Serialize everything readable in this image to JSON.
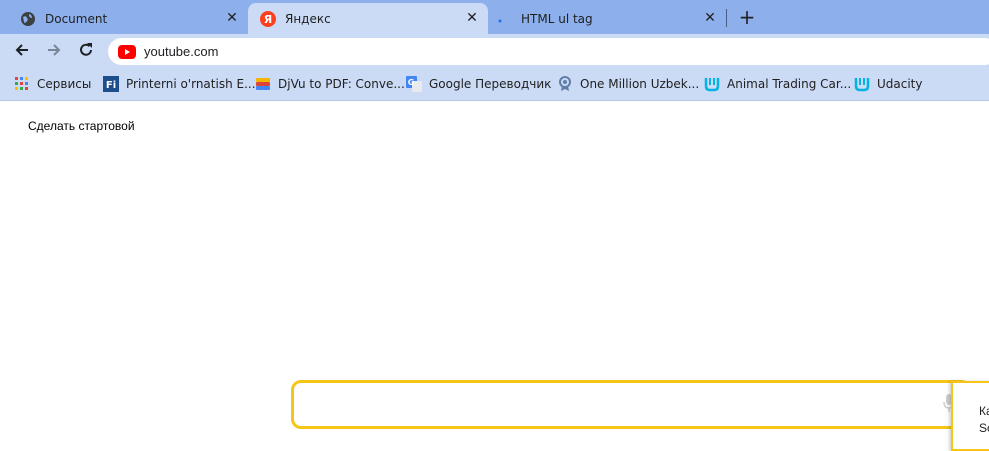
{
  "tabs": [
    {
      "title": "Document",
      "icon": "globe-icon",
      "close": "✕"
    },
    {
      "title": "Яндекс",
      "icon": "yandex-icon",
      "close": "✕"
    },
    {
      "title": "HTML ul tag",
      "icon": "dot-icon",
      "close": "✕"
    }
  ],
  "new_tab": "+",
  "toolbar": {
    "url": "youtube.com",
    "site_icon": "youtube-icon"
  },
  "bookmarks": [
    {
      "label": "Сервисы",
      "icon": "apps-grid-icon"
    },
    {
      "label": "Printerni o'rnatish E...",
      "icon": "fi-icon"
    },
    {
      "label": "DjVu to PDF: Conve...",
      "icon": "djvu-icon"
    },
    {
      "label": "Google Переводчик",
      "icon": "google-translate-icon"
    },
    {
      "label": "One Million Uzbek...",
      "icon": "ribbon-icon"
    },
    {
      "label": "Animal Trading Car...",
      "icon": "udacity-icon"
    },
    {
      "label": "Udacity",
      "icon": "udacity-icon"
    }
  ],
  "page": {
    "make_start": "Сделать стартовой",
    "popup_line1": "Ка",
    "popup_line2": "Sc"
  },
  "colors": {
    "tabstrip": "#8db0ec",
    "active_tab": "#cbdaf5",
    "search_border": "#f5c518",
    "youtube_red": "#ff0000",
    "udacity_blue": "#02b3e4"
  }
}
